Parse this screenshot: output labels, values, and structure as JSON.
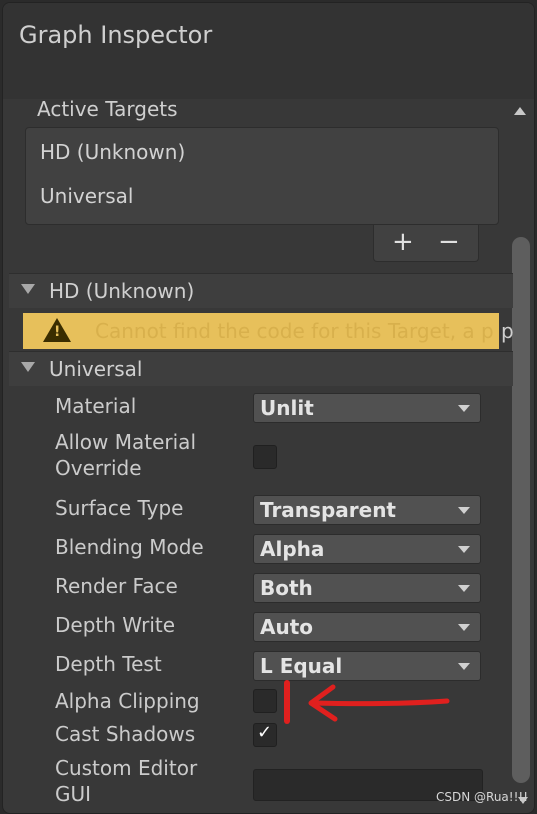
{
  "window": {
    "title": "Graph Inspector"
  },
  "targets": {
    "label": "Active Targets",
    "items": [
      {
        "label": "HD (Unknown)"
      },
      {
        "label": "Universal"
      }
    ],
    "add": "+",
    "remove": "−"
  },
  "hd_section": {
    "label": "HD (Unknown)",
    "warning": "Cannot find the code for this Target, a p",
    "warning_tail": "p",
    "warning_color": "#e7c05b"
  },
  "universal_section": {
    "label": "Universal",
    "props": {
      "material": {
        "label": "Material",
        "value": "Unlit"
      },
      "allow_override": {
        "label": "Allow Material Override",
        "checked": false
      },
      "surface_type": {
        "label": "Surface Type",
        "value": "Transparent"
      },
      "blending_mode": {
        "label": "Blending Mode",
        "value": "Alpha"
      },
      "render_face": {
        "label": "Render Face",
        "value": "Both"
      },
      "depth_write": {
        "label": "Depth Write",
        "value": "Auto"
      },
      "depth_test": {
        "label": "Depth Test",
        "value": "L Equal"
      },
      "alpha_clipping": {
        "label": "Alpha Clipping",
        "checked": false
      },
      "cast_shadows": {
        "label": "Cast Shadows",
        "checked": true
      },
      "custom_editor": {
        "label": "Custom Editor GUI",
        "value": ""
      }
    }
  },
  "annotation_color": "#e0201e",
  "watermark": "CSDN @Rua!!!!"
}
